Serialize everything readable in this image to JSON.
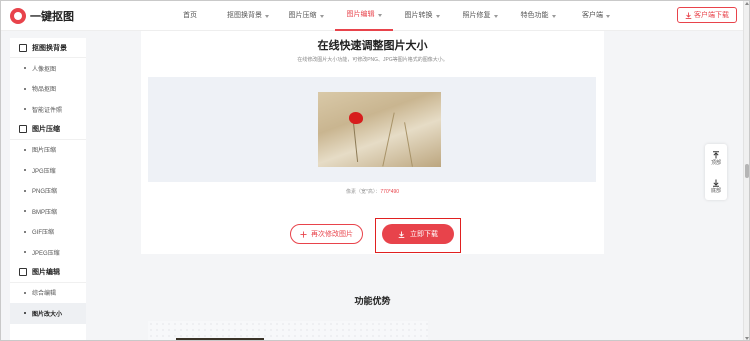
{
  "header": {
    "logo_text": "一键抠图",
    "nav": [
      {
        "label": "首页",
        "has_caret": false,
        "active": false
      },
      {
        "label": "抠图换背景",
        "has_caret": true,
        "active": false
      },
      {
        "label": "图片压缩",
        "has_caret": true,
        "active": false
      },
      {
        "label": "图片编辑",
        "has_caret": true,
        "active": true
      },
      {
        "label": "图片转换",
        "has_caret": true,
        "active": false
      },
      {
        "label": "照片修复",
        "has_caret": true,
        "active": false
      },
      {
        "label": "特色功能",
        "has_caret": true,
        "active": false
      },
      {
        "label": "客户端",
        "has_caret": true,
        "active": false
      }
    ],
    "download_button": "客户端下载"
  },
  "sidebar": {
    "groups": [
      {
        "title": "抠图换背景",
        "icon": "crop-icon",
        "items": [
          "人像抠图",
          "物品抠图",
          "智能证件照"
        ]
      },
      {
        "title": "图片压缩",
        "icon": "compress-icon",
        "items": [
          "图片压缩",
          "JPG压缩",
          "PNG压缩",
          "BMP压缩",
          "GIF压缩",
          "JPEG压缩"
        ]
      },
      {
        "title": "图片编辑",
        "icon": "image-edit-icon",
        "items": [
          "综合编辑",
          "图片改大小"
        ]
      }
    ],
    "active_item": "图片改大小"
  },
  "main": {
    "title": "在线快速调整图片大小",
    "subtitle": "在线修改图片大小功能，可修改PNG、JPG等图片格式的图像大小。",
    "pixel_label": "像素（宽*高）：",
    "pixel_value": "770*490",
    "modify_again_button": "再次修改图片",
    "download_now_button": "立即下载"
  },
  "float_tools": {
    "top_label": "顶部",
    "bottom_label": "底部"
  },
  "features": {
    "title": "功能优势"
  },
  "colors": {
    "accent": "#e8434b",
    "highlight_box": "#e02020"
  }
}
